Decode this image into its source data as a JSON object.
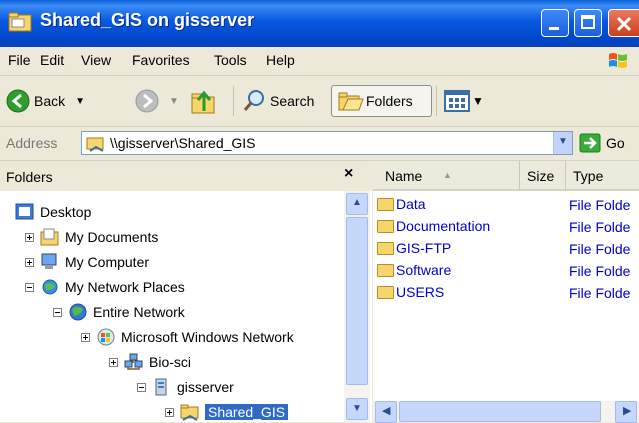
{
  "window": {
    "title": "Shared_GIS on gisserver"
  },
  "menu": [
    "File",
    "Edit",
    "View",
    "Favorites",
    "Tools",
    "Help"
  ],
  "toolbar": {
    "back": "Back",
    "search": "Search",
    "folders": "Folders"
  },
  "address": {
    "label": "Address",
    "value": "\\\\gisserver\\Shared_GIS",
    "go": "Go"
  },
  "folders_pane": {
    "title": "Folders",
    "tree": [
      {
        "label": "Desktop",
        "icon": "desktop-icon"
      },
      {
        "label": "My Documents",
        "icon": "my-documents-icon"
      },
      {
        "label": "My Computer",
        "icon": "my-computer-icon"
      },
      {
        "label": "My Network Places",
        "icon": "network-places-icon"
      },
      {
        "label": "Entire Network",
        "icon": "entire-network-icon"
      },
      {
        "label": "Microsoft Windows Network",
        "icon": "windows-network-icon"
      },
      {
        "label": "Bio-sci",
        "icon": "workgroup-icon"
      },
      {
        "label": "gisserver",
        "icon": "server-icon"
      },
      {
        "label": "Shared_GIS",
        "icon": "shared-folder-icon",
        "selected": true
      }
    ]
  },
  "list": {
    "columns": [
      "Name",
      "Size",
      "Type"
    ],
    "rows": [
      {
        "name": "Data",
        "type": "File Folde"
      },
      {
        "name": "Documentation",
        "type": "File Folde"
      },
      {
        "name": "GIS-FTP",
        "type": "File Folde"
      },
      {
        "name": "Software",
        "type": "File Folde"
      },
      {
        "name": "USERS",
        "type": "File Folde"
      }
    ]
  },
  "colors": {
    "title_bar": "#0858e0",
    "selection": "#316ac5",
    "link": "#0000cc",
    "chrome": "#ece9d8"
  }
}
